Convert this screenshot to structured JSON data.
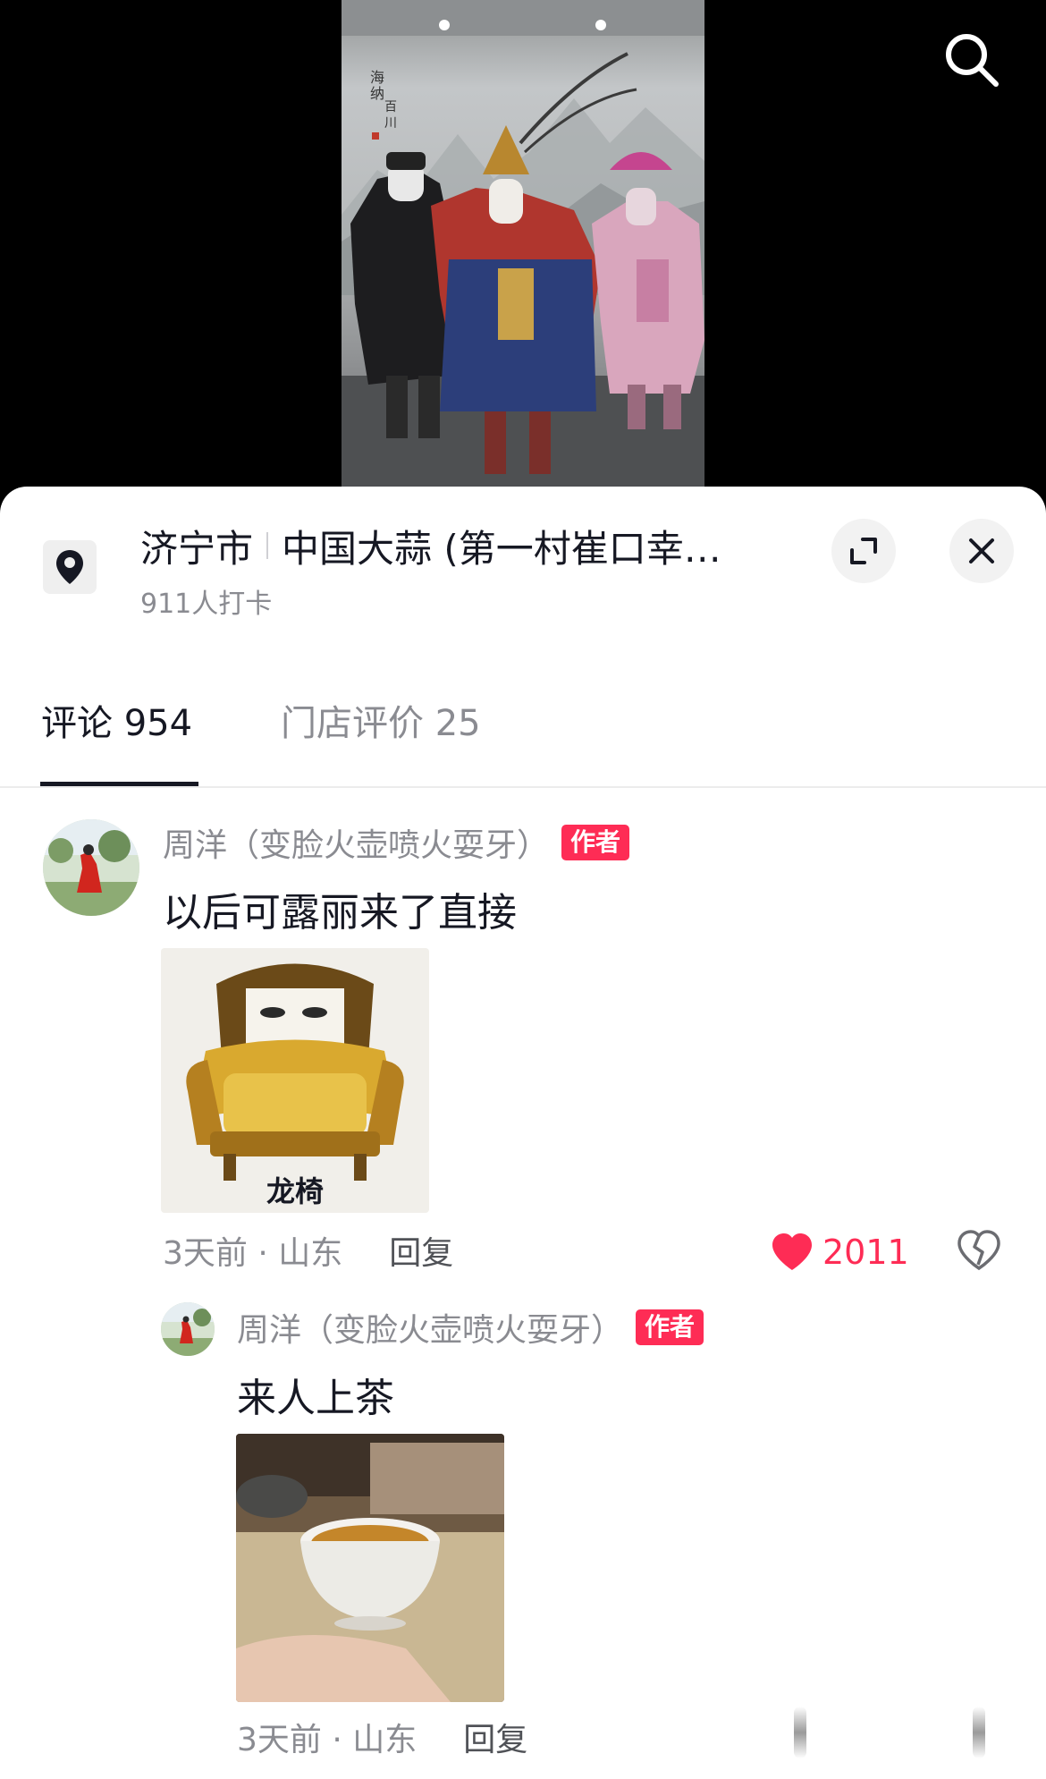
{
  "location": {
    "city": "济宁市",
    "place": "中国大蒜 (第一村崔口幸…",
    "checkins": "911人打卡"
  },
  "tabs": [
    {
      "label": "评论 954",
      "active": true
    },
    {
      "label": "门店评价 25",
      "active": false
    }
  ],
  "comments": [
    {
      "nickname": "周洋（变脸火壶喷火耍牙）",
      "badge": "作者",
      "text": "以后可露丽来了直接",
      "image_caption": "龙椅",
      "time_region": "3天前 · 山东",
      "reply_label": "回复",
      "likes": "2011",
      "liked": true
    },
    {
      "nickname": "周洋（变脸火壶喷火耍牙）",
      "badge": "作者",
      "text": "来人上茶",
      "time_region": "3天前 · 山东",
      "reply_label": "回复"
    }
  ],
  "colors": {
    "accent": "#fe2c55",
    "text_primary": "#161823",
    "text_secondary": "#8a8b91"
  },
  "icons": {
    "search": "search-icon",
    "location": "location-pin-icon",
    "expand": "expand-icon",
    "close": "close-icon",
    "like": "heart-icon",
    "dislike": "broken-heart-icon"
  }
}
